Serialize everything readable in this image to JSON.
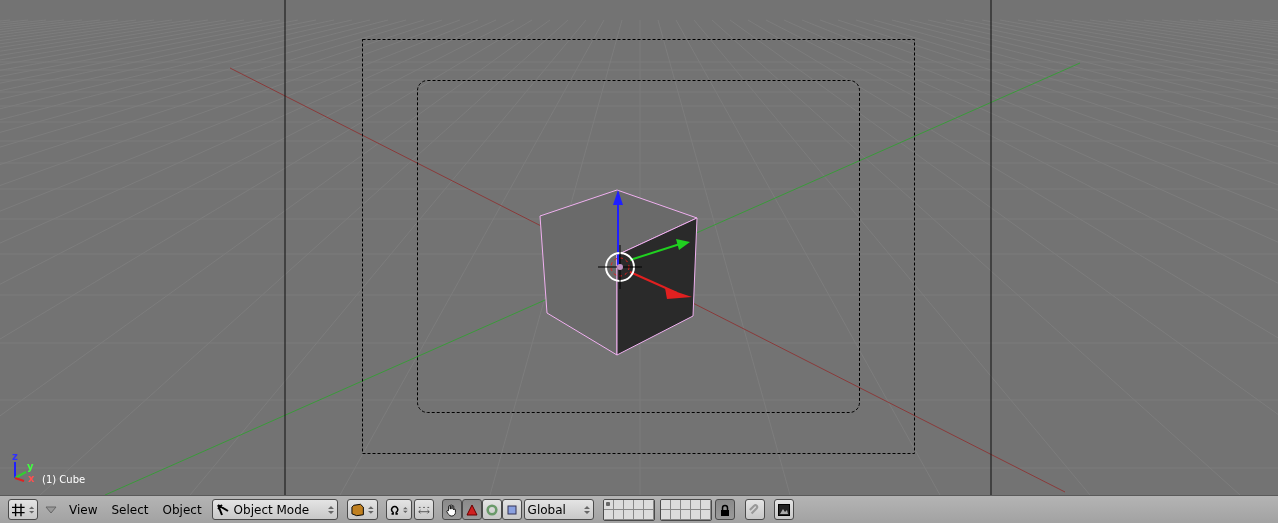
{
  "viewport": {
    "object_label": "(1) Cube",
    "axis_labels": [
      {
        "kind": "z",
        "label": "z"
      },
      {
        "kind": "y",
        "label": "y"
      },
      {
        "kind": "x",
        "label": "x"
      }
    ]
  },
  "header": {
    "menus": [
      "View",
      "Select",
      "Object"
    ],
    "mode": "Object Mode",
    "orientation": "Global",
    "manipulators": [
      {
        "kind": "hand",
        "selected": true
      },
      {
        "kind": "translate",
        "selected": true
      },
      {
        "kind": "rotate",
        "selected": false
      },
      {
        "kind": "scale",
        "selected": false
      }
    ],
    "layers": [
      {
        "occupied": true
      },
      {
        "occupied": false
      },
      {
        "occupied": false
      },
      {
        "occupied": false
      },
      {
        "occupied": false
      },
      {
        "occupied": false
      },
      {
        "occupied": false
      },
      {
        "occupied": false
      },
      {
        "occupied": false
      },
      {
        "occupied": false
      },
      {
        "occupied": false
      },
      {
        "occupied": false
      },
      {
        "occupied": false
      },
      {
        "occupied": false
      },
      {
        "occupied": false
      },
      {
        "occupied": false
      },
      {
        "occupied": false
      },
      {
        "occupied": false
      },
      {
        "occupied": false
      },
      {
        "occupied": false
      }
    ],
    "lock": {
      "on": true
    }
  }
}
